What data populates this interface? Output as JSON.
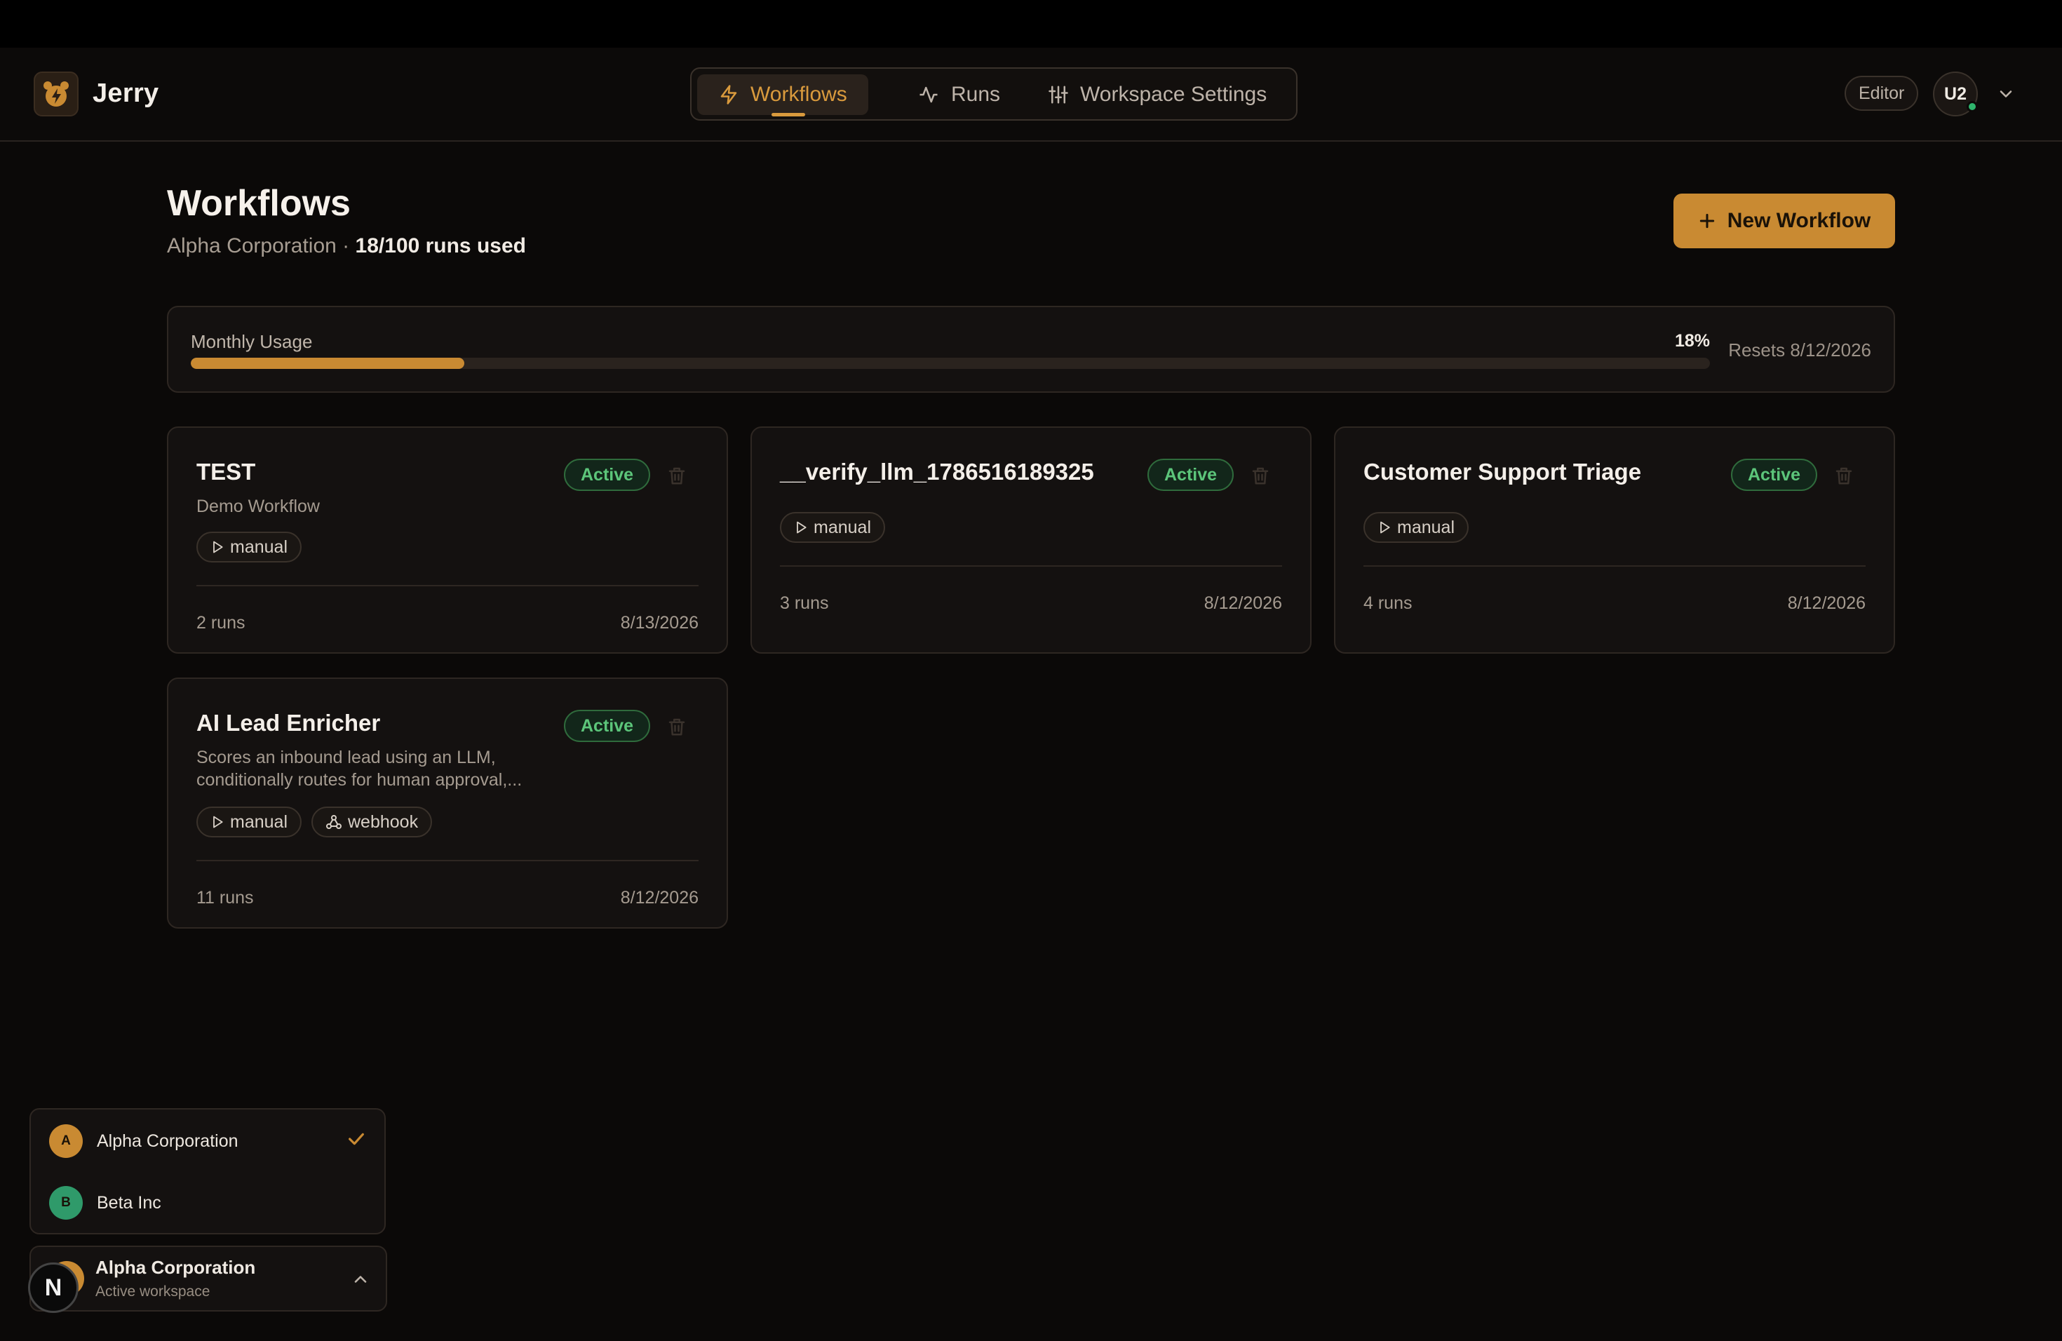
{
  "app": {
    "brand": "Jerry"
  },
  "nav": {
    "items": [
      {
        "label": "Workflows",
        "icon": "bolt-icon",
        "active": true
      },
      {
        "label": "Runs",
        "icon": "activity-icon",
        "active": false
      },
      {
        "label": "Workspace Settings",
        "icon": "sliders-icon",
        "active": false
      }
    ]
  },
  "user": {
    "role": "Editor",
    "initials": "U2",
    "status": "online"
  },
  "page": {
    "title": "Workflows",
    "org": "Alpha Corporation",
    "separator": "·",
    "runs_used": "18/100 runs used",
    "new_button": "New Workflow"
  },
  "usage": {
    "label": "Monthly Usage",
    "percent_label": "18%",
    "percent": 18,
    "reset": "Resets 8/12/2026"
  },
  "workflows": [
    {
      "title": "TEST",
      "description": "Demo Workflow",
      "status": "Active",
      "tags": [
        "manual"
      ],
      "runs": "2 runs",
      "date": "8/13/2026"
    },
    {
      "title": "__verify_llm_1786516189325",
      "description": "",
      "status": "Active",
      "tags": [
        "manual"
      ],
      "runs": "3 runs",
      "date": "8/12/2026"
    },
    {
      "title": "Customer Support Triage",
      "description": "",
      "status": "Active",
      "tags": [
        "manual"
      ],
      "runs": "4 runs",
      "date": "8/12/2026"
    },
    {
      "title": "AI Lead Enricher",
      "description": "Scores an inbound lead using an LLM, conditionally routes for human approval,...",
      "status": "Active",
      "tags": [
        "manual",
        "webhook"
      ],
      "runs": "11 runs",
      "date": "8/12/2026"
    }
  ],
  "workspaces": {
    "options": [
      {
        "initial": "A",
        "name": "Alpha Corporation",
        "selected": true,
        "color": "#c98a32"
      },
      {
        "initial": "B",
        "name": "Beta Inc",
        "selected": false,
        "color": "#2f9a6a"
      }
    ],
    "current": {
      "name": "Alpha Corporation",
      "subtitle": "Active workspace"
    }
  },
  "badge": {
    "letter": "N"
  },
  "colors": {
    "accent": "#c98a32",
    "active_green": "#5cc57a",
    "background": "#0b0908"
  }
}
